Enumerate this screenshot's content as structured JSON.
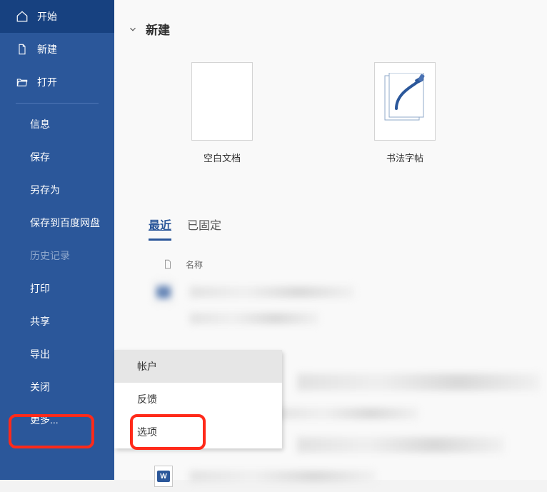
{
  "sidebar": {
    "primary": [
      {
        "icon": "home-icon",
        "label": "开始",
        "selected": true
      },
      {
        "icon": "document-icon",
        "label": "新建",
        "selected": false
      },
      {
        "icon": "folder-open-icon",
        "label": "打开",
        "selected": false
      }
    ],
    "secondary": [
      {
        "label": "信息",
        "disabled": false
      },
      {
        "label": "保存",
        "disabled": false
      },
      {
        "label": "另存为",
        "disabled": false
      },
      {
        "label": "保存到百度网盘",
        "disabled": false
      },
      {
        "label": "历史记录",
        "disabled": true
      },
      {
        "label": "打印",
        "disabled": false
      },
      {
        "label": "共享",
        "disabled": false
      },
      {
        "label": "导出",
        "disabled": false
      },
      {
        "label": "关闭",
        "disabled": false
      },
      {
        "label": "更多...",
        "disabled": false
      }
    ]
  },
  "main": {
    "new_section": {
      "title": "新建",
      "templates": [
        {
          "label": "空白文档",
          "kind": "blank"
        },
        {
          "label": "书法字帖",
          "kind": "calligraphy"
        }
      ]
    },
    "recent_section": {
      "tabs": [
        {
          "label": "最近",
          "active": true
        },
        {
          "label": "已固定",
          "active": false
        }
      ],
      "columns": {
        "name": "名称"
      }
    }
  },
  "popup": {
    "items": [
      {
        "label": "帐户",
        "hovered": true
      },
      {
        "label": "反馈",
        "hovered": false
      },
      {
        "label": "选项",
        "hovered": false
      }
    ]
  }
}
